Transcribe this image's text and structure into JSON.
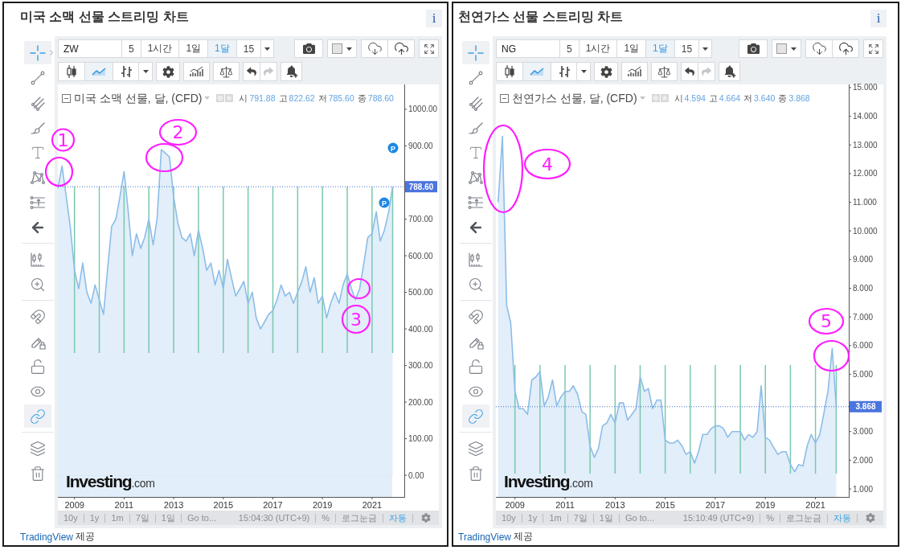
{
  "panels": [
    {
      "title": "미국 소맥 선물 스트리밍 차트",
      "info": "i",
      "drawing_tools": [
        {
          "tools": [
            {
              "selected": true,
              "hovered": true
            },
            {
              "selected": false,
              "hovered": false
            },
            {
              "selected": false,
              "hovered": false
            },
            {
              "selected": false,
              "hovered": false
            },
            {
              "selected": false,
              "hovered": false
            },
            {
              "selected": false,
              "hovered": false
            },
            {
              "selected": false,
              "hovered": false
            },
            {
              "selected": false,
              "hovered": false
            }
          ]
        },
        {
          "tools": [
            {
              "selected": false,
              "hovered": false
            },
            {
              "selected": false,
              "hovered": false
            }
          ]
        },
        {
          "tools": [
            {
              "selected": false,
              "hovered": false
            },
            {
              "selected": false,
              "hovered": false
            },
            {
              "selected": false,
              "hovered": false
            },
            {
              "selected": false,
              "hovered": false
            },
            {
              "selected": true,
              "hovered": false
            }
          ]
        },
        {
          "tools": [
            {
              "selected": false,
              "hovered": false
            },
            {
              "selected": false,
              "hovered": false
            }
          ]
        }
      ],
      "toolbar": {
        "symbol": "ZW",
        "intervals": [
          {
            "label": "5",
            "selected": false
          },
          {
            "label": "1시간",
            "selected": false
          },
          {
            "label": "1일",
            "selected": false
          },
          {
            "label": "1달",
            "selected": true
          },
          {
            "label": "15",
            "selected": false
          }
        ],
        "chart_styles": [
          {
            "selected": false
          },
          {
            "selected": true
          },
          {
            "selected": false
          }
        ],
        "history": [
          {
            "disabled": false
          },
          {
            "disabled": true
          }
        ]
      },
      "legend": {
        "title": "미국 소맥 선물, 달, (CFD)",
        "ohlc": [
          {
            "label": "시",
            "value": "791.88"
          },
          {
            "label": "고",
            "value": "822.62"
          },
          {
            "label": "저",
            "value": "785.60"
          },
          {
            "label": "종",
            "value": "788.60"
          }
        ]
      },
      "chart_data": {
        "type": "area",
        "x": [
          2008.33,
          2008.5,
          2008.67,
          2008.83,
          2009,
          2009.17,
          2009.33,
          2009.5,
          2009.67,
          2009.83,
          2010,
          2010.17,
          2010.33,
          2010.5,
          2010.67,
          2010.83,
          2011,
          2011.17,
          2011.33,
          2011.5,
          2011.67,
          2011.83,
          2012,
          2012.17,
          2012.33,
          2012.5,
          2012.67,
          2012.83,
          2013,
          2013.17,
          2013.33,
          2013.5,
          2013.67,
          2013.83,
          2014,
          2014.17,
          2014.33,
          2014.5,
          2014.67,
          2014.83,
          2015,
          2015.17,
          2015.33,
          2015.5,
          2015.67,
          2015.83,
          2016,
          2016.17,
          2016.33,
          2016.5,
          2016.67,
          2016.83,
          2017,
          2017.17,
          2017.33,
          2017.5,
          2017.67,
          2017.83,
          2018,
          2018.17,
          2018.33,
          2018.5,
          2018.67,
          2018.83,
          2019,
          2019.17,
          2019.33,
          2019.5,
          2019.67,
          2019.83,
          2020,
          2020.17,
          2020.33,
          2020.5,
          2020.67,
          2020.83,
          2021,
          2021.17,
          2021.33,
          2021.5,
          2021.67,
          2021.83
        ],
        "series": [
          {
            "color": "#8cbde9",
            "values": [
              785,
              845,
              760,
              680,
              560,
              510,
              580,
              500,
              470,
              520,
              480,
              440,
              560,
              680,
              700,
              760,
              830,
              720,
              600,
              660,
              620,
              650,
              700,
              630,
              700,
              890,
              880,
              870,
              760,
              690,
              650,
              640,
              660,
              600,
              670,
              620,
              560,
              580,
              520,
              560,
              510,
              590,
              540,
              490,
              510,
              530,
              470,
              500,
              430,
              400,
              420,
              440,
              450,
              480,
              520,
              490,
              500,
              470,
              500,
              530,
              570,
              500,
              540,
              470,
              490,
              430,
              470,
              500,
              470,
              520,
              550,
              510,
              480,
              510,
              580,
              650,
              660,
              720,
              640,
              670,
              720,
              789
            ]
          }
        ],
        "xlim": [
          2008.33,
          2022.3
        ],
        "ylim": [
          -59,
          1068
        ],
        "xticks": [
          2009,
          2011,
          2013,
          2015,
          2017,
          2019,
          2021
        ],
        "yticks": [
          {
            "value": 0,
            "label": "0.00"
          },
          {
            "value": 100,
            "label": "100.00"
          },
          {
            "value": 200,
            "label": "200.00"
          },
          {
            "value": 300,
            "label": "300.00"
          },
          {
            "value": 400,
            "label": "400.00"
          },
          {
            "value": 500,
            "label": "500.00"
          },
          {
            "value": 600,
            "label": "600.00"
          },
          {
            "value": 700,
            "label": "700.00"
          },
          {
            "value": 900,
            "label": "900.00"
          },
          {
            "value": 1000,
            "label": "1000.00"
          }
        ],
        "ref_lines": [
          {
            "axis": "x",
            "value": 2009
          },
          {
            "axis": "x",
            "value": 2010
          },
          {
            "axis": "x",
            "value": 2011
          },
          {
            "axis": "x",
            "value": 2012
          },
          {
            "axis": "x",
            "value": 2013
          },
          {
            "axis": "x",
            "value": 2014
          },
          {
            "axis": "x",
            "value": 2015
          },
          {
            "axis": "x",
            "value": 2016
          },
          {
            "axis": "x",
            "value": 2017
          },
          {
            "axis": "x",
            "value": 2018
          },
          {
            "axis": "x",
            "value": 2019
          },
          {
            "axis": "x",
            "value": 2020
          },
          {
            "axis": "x",
            "value": 2021
          },
          {
            "axis": "x",
            "value": 2021.83
          },
          {
            "axis": "y",
            "value": 788.6,
            "label": "788.60"
          }
        ]
      },
      "event_markers": [
        "P",
        "P"
      ],
      "handwritten_numbers": [
        "1",
        "2",
        "3"
      ],
      "logo": "**Investing**.com",
      "bottom_bar": {
        "ranges": [
          "10y",
          "1y",
          "1m",
          "7일",
          "1일"
        ],
        "goto": "Go to...",
        "time": "15:04:30 (UTC+9)",
        "scales": [
          {
            "label": "%",
            "on": false
          },
          {
            "label": "로그눈금",
            "on": false
          },
          {
            "label": "자동",
            "on": true
          }
        ]
      },
      "footer": {
        "link": "TradingView",
        "text": "제공"
      }
    },
    {
      "title": "천연가스 선물 스트리밍 차트",
      "info": "i",
      "drawing_tools": [
        {
          "tools": [
            {
              "selected": true,
              "hovered": false
            },
            {
              "selected": false,
              "hovered": false
            },
            {
              "selected": false,
              "hovered": false
            },
            {
              "selected": false,
              "hovered": false
            },
            {
              "selected": false,
              "hovered": false
            },
            {
              "selected": false,
              "hovered": false
            },
            {
              "selected": false,
              "hovered": false
            },
            {
              "selected": false,
              "hovered": false
            }
          ]
        },
        {
          "tools": [
            {
              "selected": false,
              "hovered": false
            },
            {
              "selected": false,
              "hovered": false
            }
          ]
        },
        {
          "tools": [
            {
              "selected": false,
              "hovered": false
            },
            {
              "selected": false,
              "hovered": false
            },
            {
              "selected": false,
              "hovered": false
            },
            {
              "selected": false,
              "hovered": false
            },
            {
              "selected": true,
              "hovered": false
            }
          ]
        },
        {
          "tools": [
            {
              "selected": false,
              "hovered": false
            },
            {
              "selected": false,
              "hovered": false
            }
          ]
        }
      ],
      "toolbar": {
        "symbol": "NG",
        "intervals": [
          {
            "label": "5",
            "selected": false
          },
          {
            "label": "1시간",
            "selected": false
          },
          {
            "label": "1일",
            "selected": false
          },
          {
            "label": "1달",
            "selected": true
          },
          {
            "label": "15",
            "selected": false
          }
        ],
        "chart_styles": [
          {
            "selected": false
          },
          {
            "selected": true
          },
          {
            "selected": false
          }
        ],
        "history": [
          {
            "disabled": false
          },
          {
            "disabled": true
          }
        ]
      },
      "legend": {
        "title": "천연가스 선물, 달, (CFD)",
        "ohlc": [
          {
            "label": "시",
            "value": "4.594"
          },
          {
            "label": "고",
            "value": "4.664"
          },
          {
            "label": "저",
            "value": "3.640"
          },
          {
            "label": "종",
            "value": "3.868"
          }
        ]
      },
      "chart_data": {
        "type": "area",
        "x": [
          2008.33,
          2008.5,
          2008.67,
          2008.83,
          2009,
          2009.17,
          2009.33,
          2009.5,
          2009.67,
          2009.83,
          2010,
          2010.17,
          2010.33,
          2010.5,
          2010.67,
          2010.83,
          2011,
          2011.17,
          2011.33,
          2011.5,
          2011.67,
          2011.83,
          2012,
          2012.17,
          2012.33,
          2012.5,
          2012.67,
          2012.83,
          2013,
          2013.17,
          2013.33,
          2013.5,
          2013.67,
          2013.83,
          2014,
          2014.17,
          2014.33,
          2014.5,
          2014.67,
          2014.83,
          2015,
          2015.17,
          2015.33,
          2015.5,
          2015.67,
          2015.83,
          2016,
          2016.17,
          2016.33,
          2016.5,
          2016.67,
          2016.83,
          2017,
          2017.17,
          2017.33,
          2017.5,
          2017.67,
          2017.83,
          2018,
          2018.17,
          2018.33,
          2018.5,
          2018.67,
          2018.83,
          2019,
          2019.17,
          2019.33,
          2019.5,
          2019.67,
          2019.83,
          2020,
          2020.17,
          2020.33,
          2020.5,
          2020.67,
          2020.83,
          2021,
          2021.17,
          2021.33,
          2021.5,
          2021.67,
          2021.83
        ],
        "series": [
          {
            "color": "#8cbde9",
            "values": [
              11.0,
              13.3,
              7.4,
              6.8,
              4.4,
              3.8,
              3.8,
              3.6,
              4.8,
              4.9,
              5.1,
              3.9,
              4.2,
              4.8,
              3.9,
              4.2,
              4.4,
              4.4,
              4.6,
              4.3,
              3.7,
              3.6,
              2.5,
              2.1,
              2.4,
              3.2,
              3.3,
              3.6,
              3.3,
              4.0,
              4.0,
              3.4,
              3.6,
              3.8,
              4.9,
              4.4,
              4.5,
              3.8,
              4.1,
              4.1,
              2.7,
              2.6,
              2.6,
              2.7,
              2.5,
              2.2,
              2.3,
              1.9,
              2.3,
              2.9,
              2.9,
              3.1,
              3.2,
              3.2,
              3.1,
              2.8,
              3.0,
              3.0,
              3.0,
              2.7,
              2.9,
              2.8,
              3.0,
              4.6,
              2.8,
              2.7,
              2.45,
              2.2,
              2.3,
              2.3,
              1.85,
              1.6,
              1.85,
              1.8,
              2.5,
              2.9,
              2.6,
              2.9,
              3.6,
              4.4,
              5.9,
              3.87
            ]
          }
        ],
        "xlim": [
          2008.24,
          2022.33
        ],
        "ylim": [
          0.72,
          15.11
        ],
        "xticks": [
          2009,
          2011,
          2013,
          2015,
          2017,
          2019,
          2021
        ],
        "yticks": [
          {
            "value": 1,
            "label": "1.000"
          },
          {
            "value": 2,
            "label": "2.000"
          },
          {
            "value": 3,
            "label": "3.000"
          },
          {
            "value": 5,
            "label": "5.000"
          },
          {
            "value": 6,
            "label": "6.000"
          },
          {
            "value": 7,
            "label": "7.000"
          },
          {
            "value": 8,
            "label": "8.000"
          },
          {
            "value": 9,
            "label": "9.000"
          },
          {
            "value": 10,
            "label": "10.000"
          },
          {
            "value": 11,
            "label": "11.000"
          },
          {
            "value": 12,
            "label": "12.000"
          },
          {
            "value": 13,
            "label": "13.000"
          },
          {
            "value": 14,
            "label": "14.000"
          },
          {
            "value": 15,
            "label": "15.000"
          }
        ],
        "ref_lines": [
          {
            "axis": "x",
            "value": 2009
          },
          {
            "axis": "x",
            "value": 2010
          },
          {
            "axis": "x",
            "value": 2011
          },
          {
            "axis": "x",
            "value": 2012
          },
          {
            "axis": "x",
            "value": 2013
          },
          {
            "axis": "x",
            "value": 2014
          },
          {
            "axis": "x",
            "value": 2015
          },
          {
            "axis": "x",
            "value": 2016
          },
          {
            "axis": "x",
            "value": 2017
          },
          {
            "axis": "x",
            "value": 2018
          },
          {
            "axis": "x",
            "value": 2019
          },
          {
            "axis": "x",
            "value": 2020
          },
          {
            "axis": "x",
            "value": 2021
          },
          {
            "axis": "x",
            "value": 2021.83
          },
          {
            "axis": "y",
            "value": 3.868,
            "label": "3.868"
          }
        ]
      },
      "handwritten_numbers": [
        "4",
        "5"
      ],
      "logo": "**Investing**.com",
      "bottom_bar": {
        "ranges": [
          "10y",
          "1y",
          "1m",
          "7일",
          "1일"
        ],
        "goto": "Go to...",
        "time": "15:10:49 (UTC+9)",
        "scales": [
          {
            "label": "%",
            "on": false
          },
          {
            "label": "로그눈금",
            "on": false
          },
          {
            "label": "자동",
            "on": true
          }
        ]
      },
      "footer": {
        "link": "TradingView",
        "text": "제공"
      }
    }
  ]
}
